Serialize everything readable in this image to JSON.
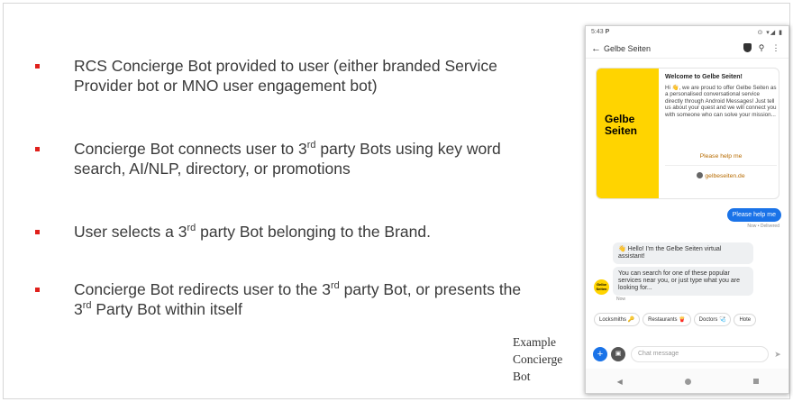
{
  "slide": {
    "bullets": [
      {
        "text": "RCS Concierge Bot provided to user (either branded Service Provider bot or MNO user engagement bot)"
      },
      {
        "pre": "Concierge Bot connects user to 3",
        "sup": "rd",
        "post": " party Bots using key word search, AI/NLP, directory, or promotions"
      },
      {
        "pre": "User selects a 3",
        "sup": "rd",
        "post": " party Bot belonging to the Brand."
      },
      {
        "pre": "Concierge Bot redirects user to the 3",
        "sup": "rd",
        "post": " party Bot, or presents the 3",
        "sup2": "rd",
        "post2": " Party Bot within itself"
      }
    ],
    "caption": [
      "Example",
      "Concierge",
      "Bot"
    ],
    "bullet_color": "#e0201b"
  },
  "phone": {
    "status_time": "5:43",
    "status_app": "P",
    "status_icons": "⊙ ▾◢ ▮",
    "header_title": "Gelbe Seiten",
    "card": {
      "logo_line1": "Gelbe",
      "logo_line2": "Seiten",
      "title": "Welcome to Gelbe Seiten!",
      "body": "Hi 👋, we are proud to offer Gelbe Seiten as a personalised conversational service directly through Android Messages! Just tell us about your quest and we will connect you with someone who can solve your mission...",
      "help_label": "Please help me",
      "site_label": "gelbeseiten.de"
    },
    "sent_message": "Please help me",
    "sent_status": "Now • Delivered",
    "bot_message_1": "👋 Hello! I'm the Gelbe Seiten virtual assistant!",
    "bot_message_2": "You can search for one of these popular services near you, or just type what you are looking for...",
    "bot_time": "Now",
    "avatar_text": "Gelbe Seiten",
    "chips": [
      "Locksmiths 🔑",
      "Restaurants 🍟",
      "Doctors 🩺",
      "Hote"
    ],
    "compose_placeholder": "Chat message",
    "accent_color": "#1a73e8",
    "brand_color": "#ffd400"
  }
}
